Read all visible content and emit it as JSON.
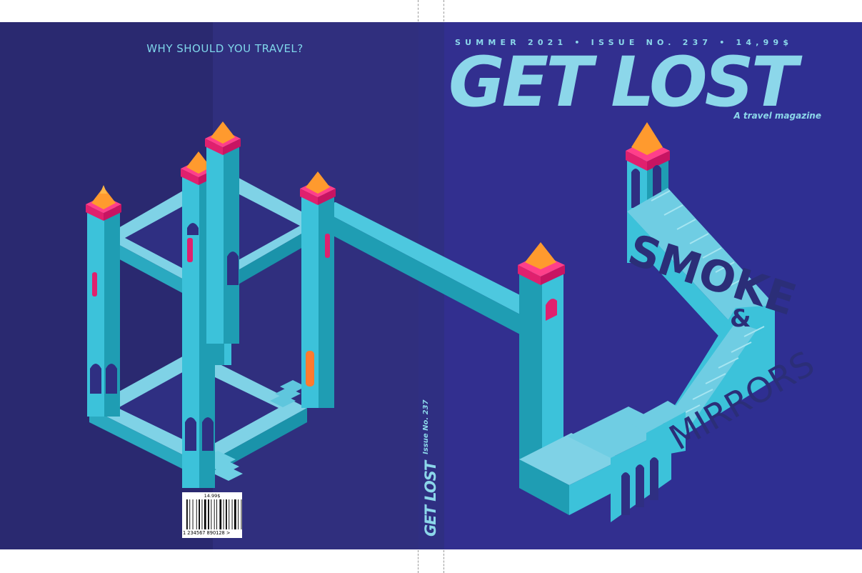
{
  "back_cover": {
    "headline": "WHY SHOULD YOU TRAVEL?",
    "barcode_price": "14.99$",
    "barcode_number": "1  234567  890128  >"
  },
  "spine": {
    "title": "GET LOST",
    "issue": "Issue No. 237"
  },
  "front_cover": {
    "issue_line": "SUMMER 2021  •  ISSUE NO. 237  •  14,99$",
    "title": "GET LOST",
    "subtitle": "A travel magazine",
    "stair_word_1": "SMOKE",
    "stair_ampersand": "&",
    "stair_word_2": "MIRRORS"
  },
  "colors": {
    "back_dark": "#2a2970",
    "back_mid": "#302f7e",
    "spine": "#2f2f82",
    "front": "#322f8f",
    "front_right": "#2f2f92",
    "accent_light": "#8cd7ea",
    "tower_cyan": "#3cc2da",
    "tower_teal": "#1f9db3",
    "roof_pink": "#ff3f8a",
    "roof_orange": "#ff9a2e"
  }
}
